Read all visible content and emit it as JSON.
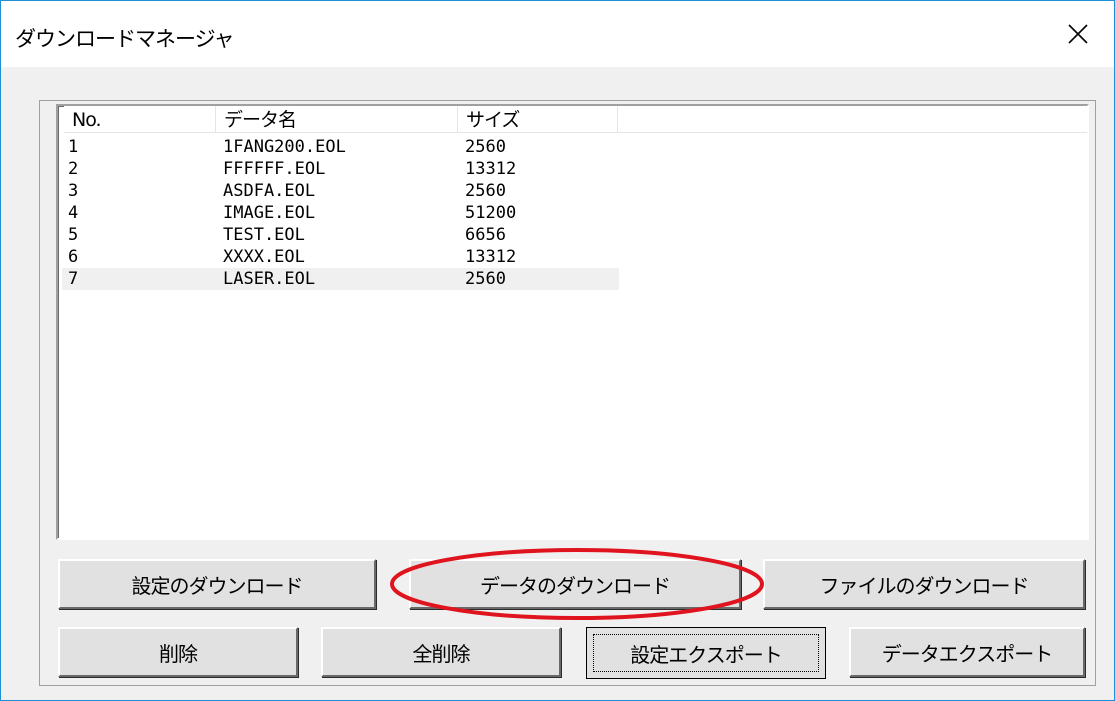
{
  "window": {
    "title": "ダウンロードマネージャ"
  },
  "list": {
    "columns": [
      "No.",
      "データ名",
      "サイズ"
    ],
    "rows": [
      {
        "no": "1",
        "name": "1FANG200.EOL",
        "size": "2560"
      },
      {
        "no": "2",
        "name": "FFFFFF.EOL",
        "size": "13312"
      },
      {
        "no": "3",
        "name": "ASDFA.EOL",
        "size": "2560"
      },
      {
        "no": "4",
        "name": "IMAGE.EOL",
        "size": "51200"
      },
      {
        "no": "5",
        "name": "TEST.EOL",
        "size": "6656"
      },
      {
        "no": "6",
        "name": "XXXX.EOL",
        "size": "13312"
      },
      {
        "no": "7",
        "name": "LASER.EOL",
        "size": "2560",
        "selected": true
      }
    ]
  },
  "buttons": {
    "download_settings": "設定のダウンロード",
    "download_data": "データのダウンロード",
    "download_file": "ファイルのダウンロード",
    "delete": "削除",
    "delete_all": "全削除",
    "export_settings": "設定エクスポート",
    "export_data": "データエクスポート"
  },
  "colors": {
    "accent_border": "#1e8fd6",
    "highlight_ellipse": "#e0141e",
    "selected_row": "#f0f0f0"
  },
  "icons": {
    "close": "close-icon"
  }
}
